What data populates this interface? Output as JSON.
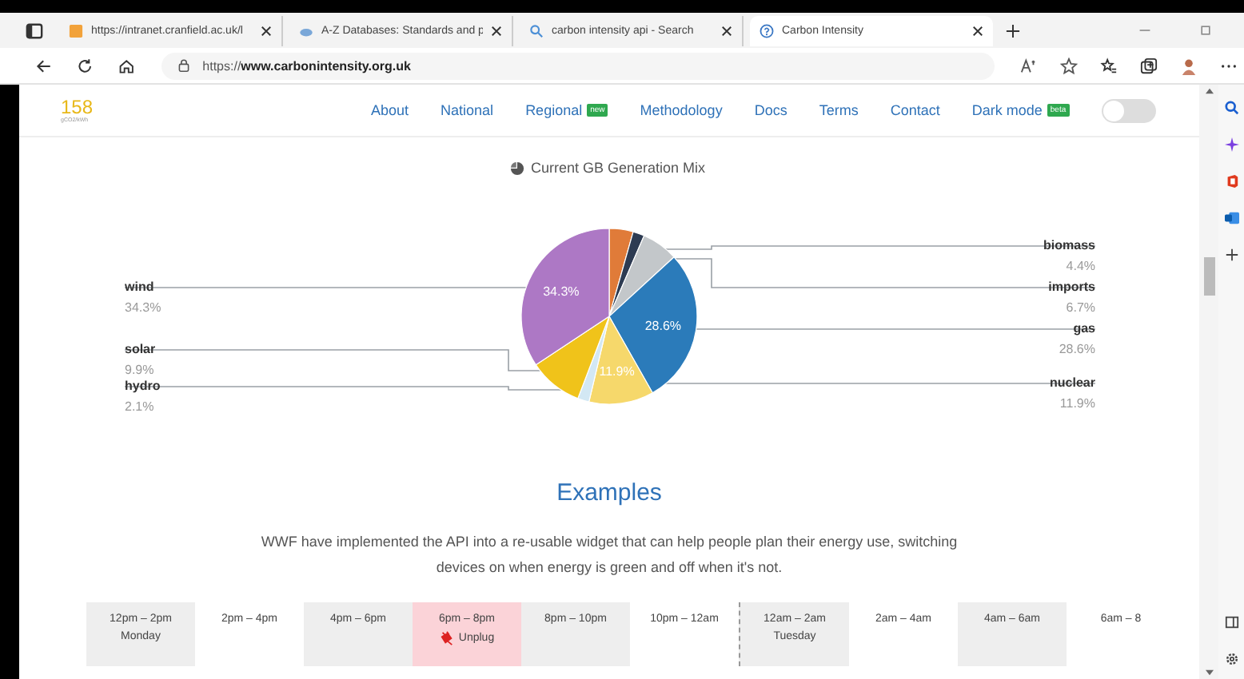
{
  "browser": {
    "tabs": [
      {
        "title": "https://intranet.cranfield.ac.uk/l",
        "selected": false
      },
      {
        "title": "A-Z Databases: Standards and p",
        "selected": false
      },
      {
        "title": "carbon intensity api - Search",
        "selected": false
      },
      {
        "title": "Carbon Intensity",
        "selected": true
      }
    ],
    "address": "https://**www.carbonintensity.org.uk**"
  },
  "header": {
    "intensity": "158",
    "unit": "gCO2/kWh",
    "nav": [
      {
        "label": "About"
      },
      {
        "label": "National"
      },
      {
        "label": "Regional",
        "badge": "new"
      },
      {
        "label": "Methodology"
      },
      {
        "label": "Docs"
      },
      {
        "label": "Terms"
      },
      {
        "label": "Contact"
      },
      {
        "label": "Dark mode",
        "badge": "beta"
      }
    ],
    "dark_mode_on": false
  },
  "chart_data": {
    "type": "pie",
    "title": "Current GB Generation Mix",
    "categories": [
      "biomass",
      null,
      "imports",
      "gas",
      "nuclear",
      "hydro",
      "solar",
      "wind"
    ],
    "values": [
      4.4,
      2.1,
      6.7,
      28.6,
      11.9,
      2.1,
      9.9,
      34.3
    ],
    "colors": [
      "#e07b39",
      "#2d3b52",
      "#c3c7ca",
      "#2b7bba",
      "#f6d86b",
      "#d3e8f4",
      "#f0c31a",
      "#ad78c5"
    ],
    "value_labels": [
      "4.4%",
      null,
      "6.7%",
      "28.6%",
      "11.9%",
      "2.1%",
      "9.9%",
      "34.3%"
    ],
    "data_labels": true
  },
  "slice_labels": [
    "28.6%",
    "11.9%",
    "34.3%"
  ],
  "examples": {
    "heading": "Examples",
    "text": "WWF have implemented the API into a re-usable widget that can help people plan their energy use, switching devices on when energy is green and off when it's not.",
    "slots": [
      {
        "time": "12pm – 2pm",
        "day": "Monday",
        "shaded": true,
        "unplug": false
      },
      {
        "time": "2pm – 4pm",
        "shaded": false,
        "unplug": false
      },
      {
        "time": "4pm – 6pm",
        "shaded": true,
        "unplug": false
      },
      {
        "time": "6pm – 8pm",
        "shaded": false,
        "unplug": true,
        "note": "Unplug"
      },
      {
        "time": "8pm – 10pm",
        "shaded": true,
        "unplug": false
      },
      {
        "time": "10pm – 12am",
        "shaded": false,
        "unplug": false
      },
      {
        "time": "12am – 2am",
        "day": "Tuesday",
        "shaded": true,
        "unplug": false
      },
      {
        "time": "2am – 4am",
        "shaded": false,
        "unplug": false
      },
      {
        "time": "4am – 6am",
        "shaded": true,
        "unplug": false
      },
      {
        "time": "6am – 8",
        "shaded": false,
        "unplug": false
      }
    ]
  }
}
